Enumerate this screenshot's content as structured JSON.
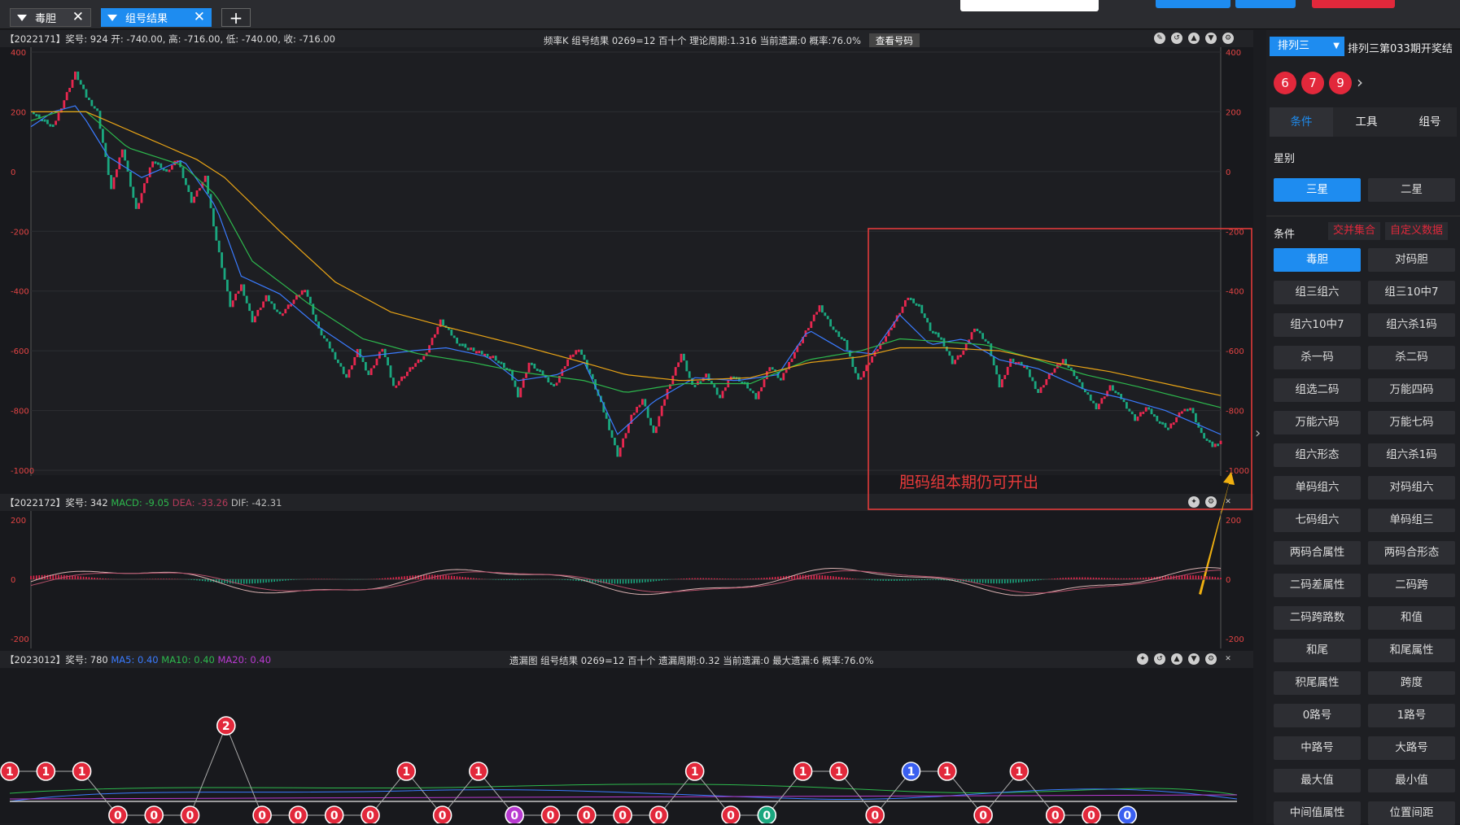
{
  "tabs": [
    {
      "label": "毒胆"
    },
    {
      "label": "组号结果"
    }
  ],
  "panel1": {
    "info": "【2022171】奖号: 924  开: -740.00, 高: -716.00, 低: -740.00, 收: -716.00",
    "mid": "频率K  组号结果  0269=12  百十个  理论周期:1.316  当前遗漏:0  概率:76.0%",
    "btn": "查看号码"
  },
  "panel2": {
    "prefix": "【2022172】奖号: 342",
    "macd": "MACD: -9.05",
    "dea": "DEA: -33.26",
    "dif": "DIF: -42.31"
  },
  "panel3": {
    "prefix": "【2023012】奖号: 780",
    "ma5": "MA5: 0.40",
    "ma10": "MA10: 0.40",
    "ma20": "MA20: 0.40",
    "mid": "遗漏图  组号结果  0269=12  百十个  遗漏周期:0.32  当前遗漏:0  最大遗漏:6  概率:76.0%"
  },
  "annotation": "胆码组本期仍可开出",
  "colors": {
    "up": "#e8274f",
    "down": "#1aa77f",
    "ma5": "#3a7bff",
    "ma10": "#2db84d",
    "ma20": "#e9a416",
    "accent": "#1e8cf0",
    "ball": "#e2283b",
    "box": "#e23b3b"
  },
  "chart_data": [
    {
      "type": "candlestick",
      "ylim": [
        -1000,
        400
      ],
      "yticks": [
        400,
        200,
        0,
        -200,
        -400,
        -600,
        -800,
        -1000
      ],
      "close_path": [
        [
          0,
          200
        ],
        [
          8,
          150
        ],
        [
          16,
          330
        ],
        [
          20,
          250
        ],
        [
          24,
          200
        ],
        [
          29,
          -60
        ],
        [
          33,
          80
        ],
        [
          38,
          -130
        ],
        [
          44,
          40
        ],
        [
          49,
          0
        ],
        [
          53,
          40
        ],
        [
          58,
          -100
        ],
        [
          63,
          -20
        ],
        [
          67,
          -230
        ],
        [
          72,
          -450
        ],
        [
          76,
          -380
        ],
        [
          80,
          -500
        ],
        [
          85,
          -420
        ],
        [
          90,
          -480
        ],
        [
          95,
          -430
        ],
        [
          99,
          -390
        ],
        [
          104,
          -530
        ],
        [
          108,
          -590
        ],
        [
          114,
          -690
        ],
        [
          118,
          -600
        ],
        [
          122,
          -680
        ],
        [
          127,
          -590
        ],
        [
          131,
          -720
        ],
        [
          138,
          -650
        ],
        [
          142,
          -620
        ],
        [
          148,
          -500
        ],
        [
          154,
          -570
        ],
        [
          158,
          -590
        ],
        [
          163,
          -610
        ],
        [
          167,
          -620
        ],
        [
          173,
          -670
        ],
        [
          176,
          -750
        ],
        [
          180,
          -640
        ],
        [
          185,
          -680
        ],
        [
          189,
          -720
        ],
        [
          194,
          -630
        ],
        [
          198,
          -590
        ],
        [
          203,
          -700
        ],
        [
          208,
          -830
        ],
        [
          212,
          -950
        ],
        [
          217,
          -820
        ],
        [
          221,
          -760
        ],
        [
          225,
          -880
        ],
        [
          230,
          -730
        ],
        [
          235,
          -610
        ],
        [
          239,
          -720
        ],
        [
          244,
          -680
        ],
        [
          249,
          -760
        ],
        [
          253,
          -680
        ],
        [
          258,
          -710
        ],
        [
          262,
          -760
        ],
        [
          267,
          -650
        ],
        [
          271,
          -700
        ],
        [
          275,
          -620
        ],
        [
          281,
          -520
        ],
        [
          285,
          -450
        ],
        [
          290,
          -530
        ],
        [
          294,
          -570
        ],
        [
          299,
          -700
        ],
        [
          304,
          -620
        ],
        [
          309,
          -550
        ],
        [
          314,
          -470
        ],
        [
          317,
          -420
        ],
        [
          321,
          -450
        ],
        [
          325,
          -530
        ],
        [
          329,
          -560
        ],
        [
          333,
          -640
        ],
        [
          337,
          -600
        ],
        [
          341,
          -520
        ],
        [
          346,
          -580
        ],
        [
          350,
          -720
        ],
        [
          354,
          -630
        ],
        [
          359,
          -650
        ],
        [
          364,
          -740
        ],
        [
          368,
          -680
        ],
        [
          373,
          -630
        ],
        [
          377,
          -680
        ],
        [
          381,
          -740
        ],
        [
          385,
          -790
        ],
        [
          390,
          -720
        ],
        [
          394,
          -760
        ],
        [
          399,
          -830
        ],
        [
          403,
          -790
        ],
        [
          407,
          -830
        ],
        [
          411,
          -860
        ],
        [
          416,
          -800
        ],
        [
          419,
          -790
        ],
        [
          423,
          -880
        ],
        [
          427,
          -920
        ],
        [
          430,
          -900
        ]
      ],
      "ma5_path": [
        [
          0,
          150
        ],
        [
          8,
          200
        ],
        [
          16,
          220
        ],
        [
          20,
          170
        ],
        [
          28,
          50
        ],
        [
          40,
          -20
        ],
        [
          55,
          40
        ],
        [
          67,
          -120
        ],
        [
          76,
          -350
        ],
        [
          90,
          -410
        ],
        [
          104,
          -520
        ],
        [
          120,
          -620
        ],
        [
          138,
          -600
        ],
        [
          150,
          -590
        ],
        [
          165,
          -620
        ],
        [
          176,
          -700
        ],
        [
          190,
          -680
        ],
        [
          200,
          -640
        ],
        [
          212,
          -880
        ],
        [
          225,
          -770
        ],
        [
          240,
          -690
        ],
        [
          255,
          -700
        ],
        [
          270,
          -680
        ],
        [
          281,
          -530
        ],
        [
          294,
          -600
        ],
        [
          304,
          -610
        ],
        [
          314,
          -480
        ],
        [
          325,
          -580
        ],
        [
          337,
          -560
        ],
        [
          350,
          -630
        ],
        [
          364,
          -660
        ],
        [
          381,
          -730
        ],
        [
          395,
          -760
        ],
        [
          410,
          -800
        ],
        [
          430,
          -880
        ]
      ],
      "ma10_path": [
        [
          0,
          170
        ],
        [
          10,
          200
        ],
        [
          20,
          200
        ],
        [
          35,
          80
        ],
        [
          55,
          20
        ],
        [
          67,
          -80
        ],
        [
          80,
          -300
        ],
        [
          100,
          -440
        ],
        [
          120,
          -560
        ],
        [
          140,
          -610
        ],
        [
          160,
          -640
        ],
        [
          176,
          -670
        ],
        [
          200,
          -700
        ],
        [
          215,
          -740
        ],
        [
          235,
          -710
        ],
        [
          260,
          -710
        ],
        [
          281,
          -630
        ],
        [
          300,
          -600
        ],
        [
          314,
          -560
        ],
        [
          330,
          -570
        ],
        [
          345,
          -580
        ],
        [
          360,
          -620
        ],
        [
          381,
          -680
        ],
        [
          400,
          -720
        ],
        [
          430,
          -790
        ]
      ],
      "ma20_path": [
        [
          0,
          200
        ],
        [
          20,
          200
        ],
        [
          40,
          120
        ],
        [
          60,
          40
        ],
        [
          70,
          -20
        ],
        [
          90,
          -200
        ],
        [
          110,
          -370
        ],
        [
          130,
          -470
        ],
        [
          150,
          -520
        ],
        [
          176,
          -580
        ],
        [
          200,
          -640
        ],
        [
          215,
          -680
        ],
        [
          235,
          -700
        ],
        [
          260,
          -690
        ],
        [
          281,
          -640
        ],
        [
          300,
          -620
        ],
        [
          314,
          -590
        ],
        [
          330,
          -590
        ],
        [
          350,
          -600
        ],
        [
          370,
          -640
        ],
        [
          390,
          -670
        ],
        [
          410,
          -710
        ],
        [
          430,
          -750
        ]
      ]
    },
    {
      "type": "bar",
      "title": "MACD",
      "ylim": [
        -200,
        200
      ],
      "yticks": [
        200,
        0,
        -200
      ]
    },
    {
      "type": "line",
      "title": "遗漏图",
      "values": [
        1,
        1,
        1,
        0,
        0,
        0,
        2,
        0,
        0,
        0,
        0,
        1,
        0,
        1,
        0,
        0,
        0,
        0,
        0,
        1,
        0,
        0,
        1,
        1,
        0,
        1,
        1,
        0,
        1,
        0,
        0,
        0
      ]
    }
  ],
  "sidebar": {
    "lottery": "排列三",
    "period": "排列三第033期开奖结",
    "balls": [
      "6",
      "7",
      "9"
    ],
    "tabs": [
      "条件",
      "工具",
      "组号"
    ],
    "star_label": "星别",
    "stars": [
      "三星",
      "二星"
    ],
    "cond_label": "条件",
    "cond_tags": [
      "交并集合",
      "自定义数据"
    ],
    "buttons": [
      "毒胆",
      "对码胆",
      "组三组六",
      "组三10中7",
      "组六10中7",
      "组六杀1码",
      "杀一码",
      "杀二码",
      "组选二码",
      "万能四码",
      "万能六码",
      "万能七码",
      "组六形态",
      "组六杀1码",
      "单码组六",
      "对码组六",
      "七码组六",
      "单码组三",
      "两码合属性",
      "两码合形态",
      "二码差属性",
      "二码跨",
      "二码跨路数",
      "和值",
      "和尾",
      "和尾属性",
      "积尾属性",
      "跨度",
      "0路号",
      "1路号",
      "中路号",
      "大路号",
      "最大值",
      "最小值",
      "中间值属性",
      "位置间距"
    ]
  }
}
